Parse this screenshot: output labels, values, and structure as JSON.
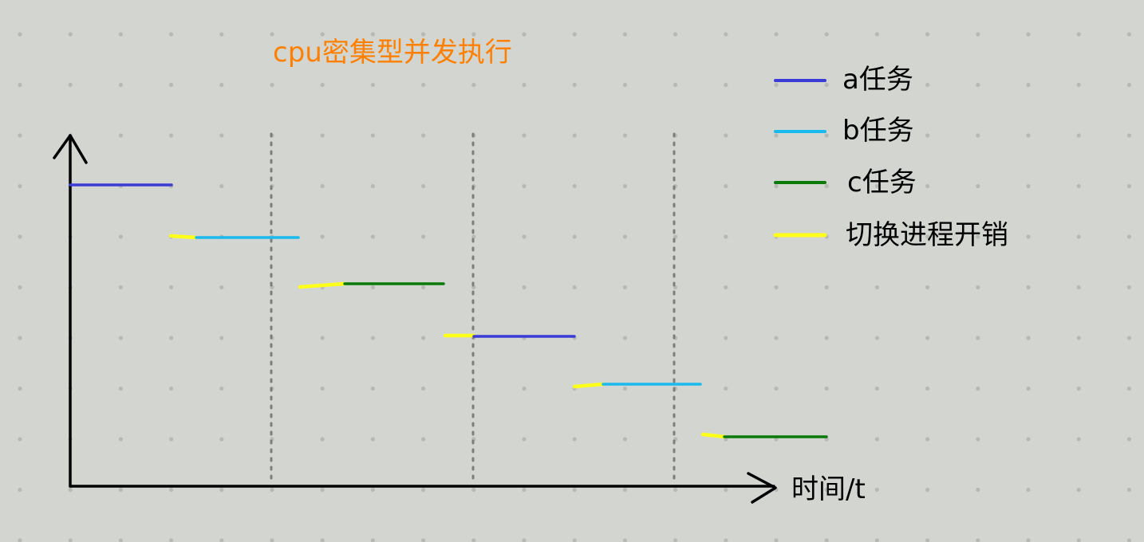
{
  "diagram": {
    "title": "cpu密集型并发执行",
    "x_axis_label": "时间/t",
    "legend": [
      {
        "key": "a",
        "label": "a任务",
        "color": "#3b3bd6"
      },
      {
        "key": "b",
        "label": "b任务",
        "color": "#1ab9ee"
      },
      {
        "key": "c",
        "label": "c任务",
        "color": "#0b7a0b"
      },
      {
        "key": "switch",
        "label": "切换进程开销",
        "color": "#ffff1a"
      }
    ],
    "colors": {
      "background": "#d3d6d0",
      "grid_dot": "#b7bab4",
      "axis": "#000000",
      "divider": "#7d7d7d",
      "title": "#ff8000"
    },
    "timeline": [
      {
        "task": "a",
        "order": 1
      },
      {
        "task": "switch",
        "order": 2
      },
      {
        "task": "b",
        "order": 3
      },
      {
        "task": "switch",
        "order": 4
      },
      {
        "task": "c",
        "order": 5
      },
      {
        "task": "switch",
        "order": 6
      },
      {
        "task": "a",
        "order": 7
      },
      {
        "task": "switch",
        "order": 8
      },
      {
        "task": "b",
        "order": 9
      },
      {
        "task": "switch",
        "order": 10
      },
      {
        "task": "c",
        "order": 11
      }
    ]
  }
}
